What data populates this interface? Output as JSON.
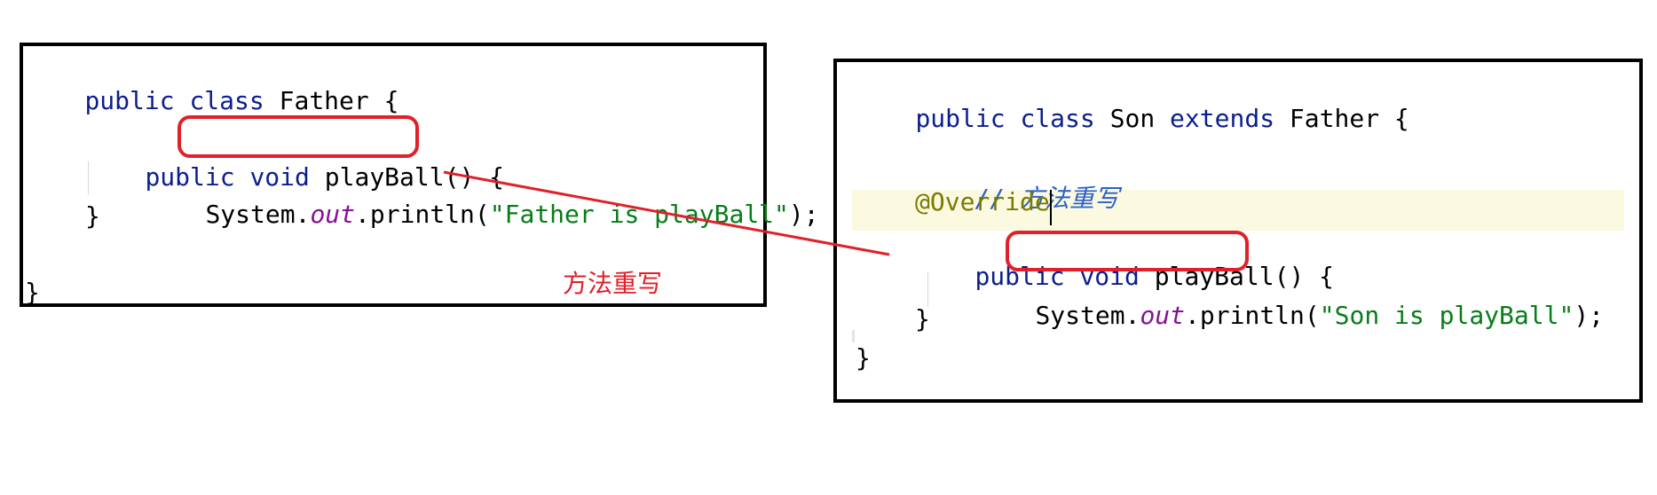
{
  "father": {
    "line1": {
      "kw1": "public",
      "kw2": "class",
      "rest": " Father {"
    },
    "line3": {
      "kw": "public",
      "kw_void": "void",
      "rest": " playBall() {"
    },
    "line4": {
      "pre": "System.",
      "field": "out",
      "mid": ".println(",
      "str": "\"Father is playBall\"",
      "post": ");"
    },
    "line5": "}",
    "line7": "}"
  },
  "son": {
    "line1": {
      "kw1": "public",
      "kw2": "class",
      "name": " Son ",
      "kw3": "extends",
      "rest": " Father {"
    },
    "comment": {
      "slashes": "//",
      "text": "方法重写"
    },
    "annotation": "@Override",
    "line_method": {
      "kw": "public",
      "kw_void": "void",
      "rest": " playBall() {"
    },
    "line_body": {
      "pre": "System.",
      "field": "out",
      "mid": ".println(",
      "str": "\"Son is playBall\"",
      "post": ");"
    },
    "close_method": "}",
    "close_class": "}"
  },
  "annotation_label": "方法重写",
  "colors": {
    "keyword": "#0b1e8f",
    "string": "#067d17",
    "field": "#871094",
    "annotation": "#7b7b00",
    "comment": "#2a62c8",
    "highlight": "#e0202a"
  }
}
